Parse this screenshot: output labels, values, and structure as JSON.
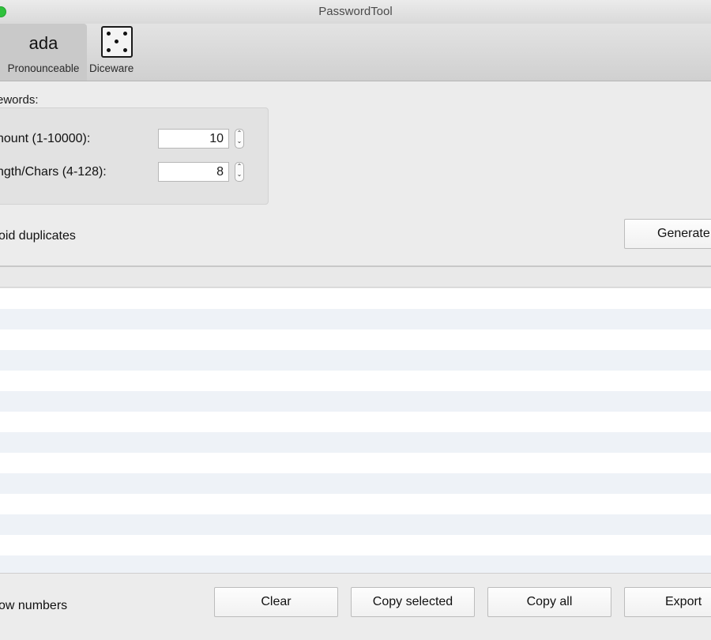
{
  "window": {
    "title": "PasswordTool"
  },
  "toolbar": {
    "items": [
      {
        "icon_text": "ada",
        "label": "Pronounceable",
        "selected": true
      },
      {
        "icon": "dice-icon",
        "label": "Diceware",
        "selected": false
      }
    ]
  },
  "form": {
    "section_label": "ewords:",
    "amount": {
      "label": "nount (1-10000):",
      "value": "10"
    },
    "length": {
      "label": "ngth/Chars (4-128):",
      "value": "8"
    },
    "avoid_duplicates_label": "oid duplicates",
    "generate_label": "Generate"
  },
  "results": {
    "rows": 13
  },
  "bottom": {
    "show_numbers_label": "ow numbers",
    "clear_label": "Clear",
    "copy_selected_label": "Copy selected",
    "copy_all_label": "Copy all",
    "export_label": "Export"
  },
  "colors": {
    "row_alt": "#eef2f7",
    "window_bg": "#ececec",
    "close_button": "#2fc13c"
  }
}
